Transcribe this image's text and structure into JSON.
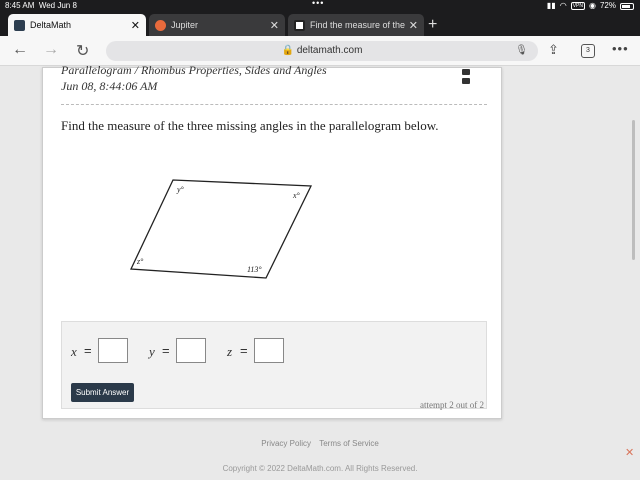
{
  "status": {
    "time": "8:45 AM",
    "date": "Wed Jun 8",
    "battery": "72%",
    "vpn": "VPN"
  },
  "tabs": [
    {
      "label": "DeltaMath",
      "favicon_color": "#2d3e50"
    },
    {
      "label": "Jupiter",
      "favicon_color": "#e86a3c"
    },
    {
      "label": "Find the measure of the t",
      "favicon_color": "#222222"
    }
  ],
  "browser": {
    "url": "deltamath.com",
    "tab_count": "3"
  },
  "problem": {
    "breadcrumb": "Parallelogram / Rhombus Properties, Sides and Angles",
    "timestamp": "Jun 08, 8:44:06 AM",
    "question": "Find the measure of the three missing angles in the parallelogram below.",
    "angles": {
      "y": "y°",
      "x": "x°",
      "z": "z°",
      "given": "113°"
    }
  },
  "answer": {
    "vars": [
      {
        "name": "x",
        "eq": "="
      },
      {
        "name": "y",
        "eq": "="
      },
      {
        "name": "z",
        "eq": "="
      }
    ],
    "submit_label": "Submit Answer",
    "attempt": "attempt 2 out of 2"
  },
  "footer": {
    "privacy": "Privacy Policy",
    "terms": "Terms of Service",
    "copyright": "Copyright © 2022 DeltaMath.com. All Rights Reserved."
  }
}
